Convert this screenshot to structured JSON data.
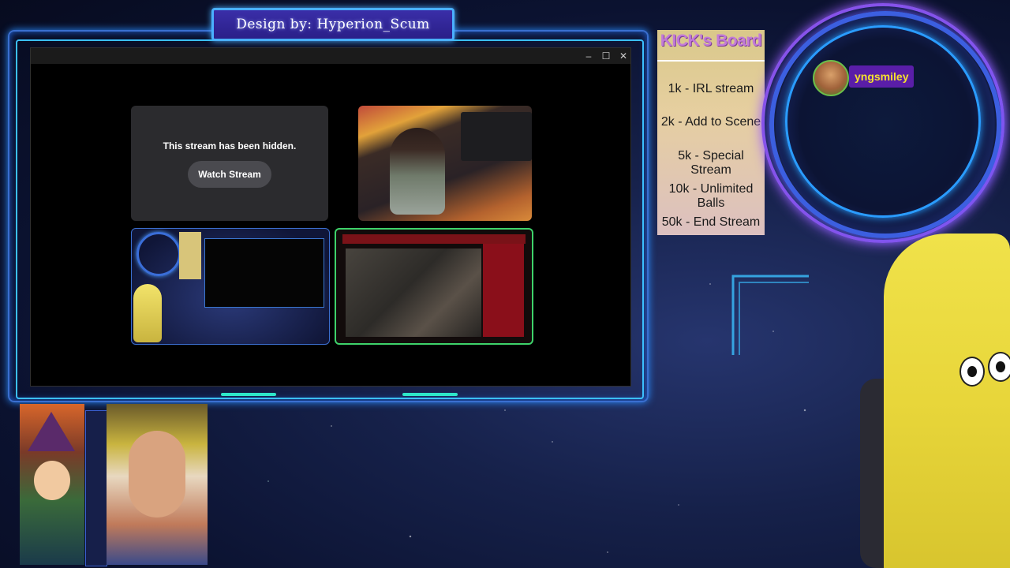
{
  "banner": {
    "text": "Design by: Hyperion_Scum"
  },
  "window": {
    "controls": {
      "minimize": "–",
      "maximize": "☐",
      "close": "✕"
    }
  },
  "hidden_stream": {
    "message": "This stream has been hidden.",
    "button": "Watch Stream"
  },
  "kick_board": {
    "title": "KICK's Board",
    "items": [
      "1k - IRL stream",
      "2k - Add to Scene",
      "5k - Special Stream",
      "10k - Unlimited Balls",
      "50k - End Stream"
    ]
  },
  "chat": {
    "username": "yngsmiley"
  },
  "colors": {
    "frame": "#3a6fd0",
    "frame_glow": "#3bc0ff",
    "accent": "#2ee6c8",
    "chat_badge": "#5a1ea8",
    "chat_name": "#f5e12e",
    "game_border": "#3ed26a"
  },
  "icons": {
    "minimize": "minimize-icon",
    "maximize": "maximize-icon",
    "close": "close-icon"
  }
}
